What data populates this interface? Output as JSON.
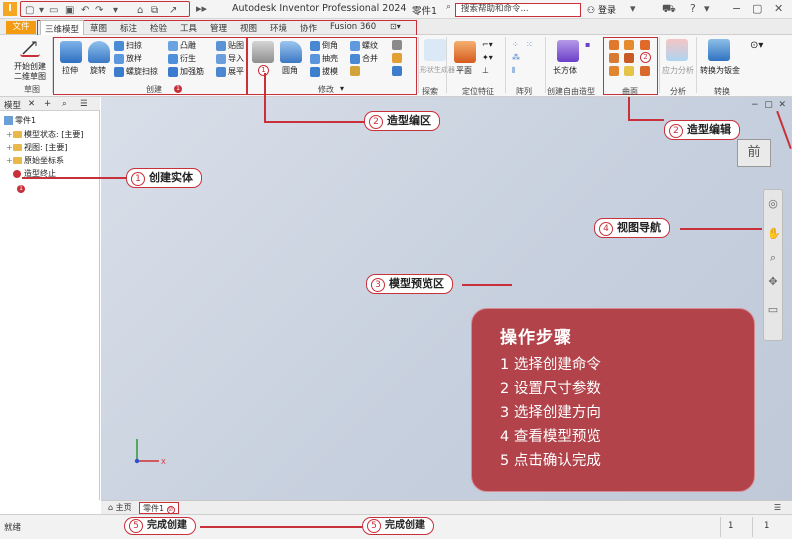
{
  "titlebar": {
    "app_title": "Autodesk Inventor Professional 2024",
    "doc_title": "零件1",
    "search_placeholder": "搜索帮助和命令...",
    "login_label": "登录"
  },
  "ribbon_tabs": {
    "file": "文件",
    "items": [
      "三维模型",
      "草图",
      "标注",
      "检验",
      "工具",
      "管理",
      "视图",
      "环境",
      "协作",
      "Fusion 360"
    ],
    "active": "三维模型"
  },
  "ribbon": {
    "sketch_group": {
      "btn_line1": "开始创建",
      "btn_line2": "二维草图",
      "label": "草图"
    },
    "create_group": {
      "label": "创建",
      "extrude": "拉伸",
      "revolve": "旋转",
      "sweep": "扫掠",
      "loft": "放样",
      "coil": "螺旋扫掠",
      "emboss": "凸雕",
      "derive": "衍生",
      "rib": "加强筋",
      "decal": "贴图",
      "import": "导入",
      "unwrap": "展平",
      "badge": "1"
    },
    "modify_group": {
      "label": "修改",
      "hole": "孔",
      "fillet": "圆角",
      "chamfer": "倒角",
      "shell": "抽壳",
      "draft": "拔模",
      "thread": "螺纹",
      "combine": "合并",
      "split": "分割",
      "badge": "1"
    },
    "explore_group": {
      "label": "探索",
      "btn": "形状生成器"
    },
    "work_group": {
      "label": "定位特征",
      "plane": "平面"
    },
    "pattern_group": {
      "label": "阵列"
    },
    "freeform_group": {
      "label": "创建自由造型",
      "box": "长方体"
    },
    "surface_group": {
      "label": "曲面"
    },
    "analysis_group": {
      "label": "分析",
      "btn": "应力分析"
    },
    "convert_group": {
      "label": "转换",
      "btn": "转换为钣金"
    }
  },
  "browser": {
    "tab_model": "模型",
    "root": "零件1",
    "items": [
      "模型状态: [主要]",
      "视图: [主要]",
      "原始坐标系",
      "造型终止"
    ]
  },
  "viewport": {
    "viewcube_label": "前"
  },
  "steps": {
    "title": "操作步骤",
    "items": [
      "1 选择创建命令",
      "2 设置尺寸参数",
      "3 选择创建方向",
      "4 查看模型预览",
      "5 点击确认完成"
    ]
  },
  "callouts": {
    "create_solid": {
      "num": "1",
      "text": "创建实体"
    },
    "modeling_edit_area": {
      "num": "2",
      "text": "造型编区"
    },
    "modeling_edit": {
      "num": "2",
      "text": "造型编辑"
    },
    "model_preview": {
      "num": "3",
      "text": "模型预览区"
    },
    "view_nav": {
      "num": "4",
      "text": "视图导航"
    },
    "finish_create_left": {
      "num": "5",
      "text": "完成创建"
    },
    "finish_create_right": {
      "num": "5",
      "text": "完成创建"
    }
  },
  "doc_tabs": {
    "home": "主页",
    "part": "零件1"
  },
  "statusbar": {
    "text": "就绪",
    "num1": "1",
    "num2": "1"
  },
  "colors": {
    "accent_red": "#c8303a",
    "file_tab": "#f39c12",
    "steps_card": "#b2434a"
  }
}
